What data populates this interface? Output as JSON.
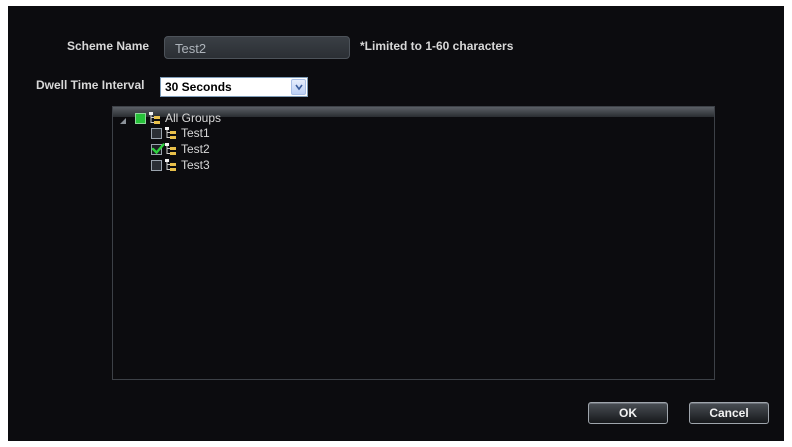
{
  "form": {
    "scheme_name_label": "Scheme Name",
    "scheme_name_value": "Test2",
    "scheme_name_hint": "*Limited to 1-60 characters",
    "dwell_label": "Dwell Time Interval",
    "dwell_selected": "30 Seconds"
  },
  "tree": {
    "root": {
      "label": "All Groups",
      "state": "partial",
      "icon": "group-icon",
      "expander": "expanded-triangle-icon"
    },
    "items": [
      {
        "label": "Test1",
        "checked": false,
        "icon": "group-icon"
      },
      {
        "label": "Test2",
        "checked": true,
        "icon": "group-icon"
      },
      {
        "label": "Test3",
        "checked": false,
        "icon": "group-icon"
      }
    ]
  },
  "buttons": {
    "ok": "OK",
    "cancel": "Cancel"
  },
  "colors": {
    "background": "#0c0c0f",
    "label_text": "#d8d8d8",
    "check_green": "#27c23a"
  }
}
